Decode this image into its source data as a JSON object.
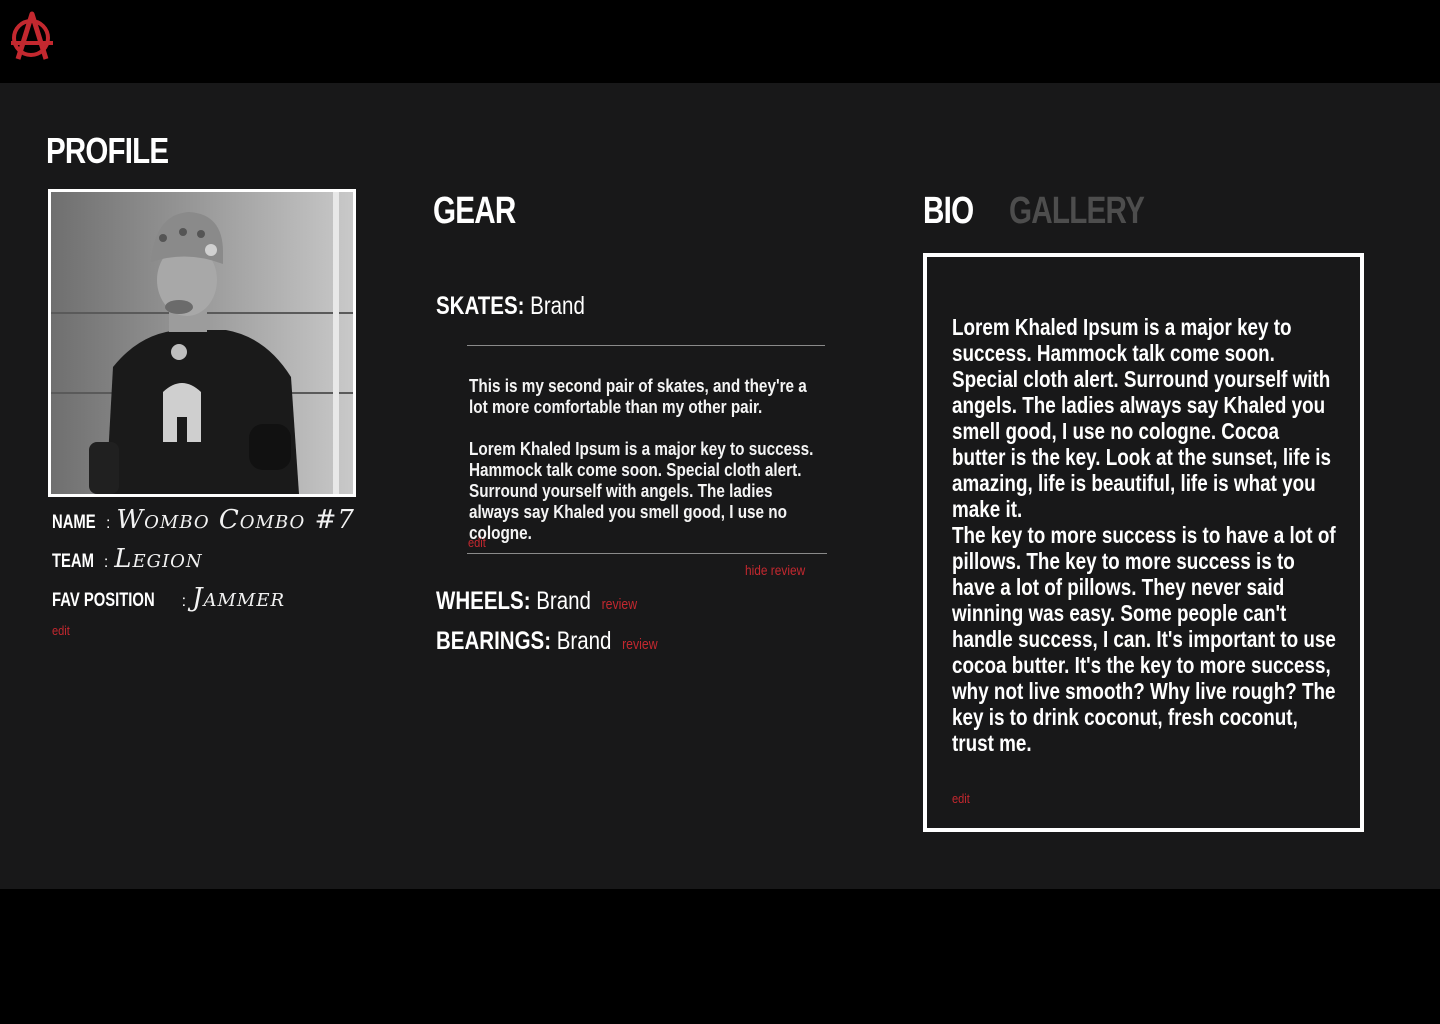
{
  "header": {
    "logo_icon": "anarchy-a-icon",
    "accent_color": "#c3282f"
  },
  "profile": {
    "title": "PROFILE",
    "photo_alt": "Profile photo of skater in helmet",
    "fields": [
      {
        "label": "NAME",
        "value": "Wombo Combo #7"
      },
      {
        "label": "TEAM",
        "value": "Legion"
      },
      {
        "label": "FAV POSITION",
        "value": "Jammer"
      }
    ],
    "edit_label": "edit"
  },
  "gear": {
    "title": "GEAR",
    "skates": {
      "label": "SKATES:",
      "brand": "Brand",
      "review_paragraph_1": "This is my second pair of skates, and they're a lot more comfortable than my other pair.",
      "review_paragraph_2": "Lorem Khaled Ipsum is a major key to success. Hammock talk come soon. Special cloth alert. Surround yourself with angels. The ladies always say Khaled you smell good, I use no cologne.",
      "edit_label": "edit",
      "hide_review_label": "hide review"
    },
    "wheels": {
      "label": "WHEELS:",
      "brand": "Brand",
      "review_label": "review"
    },
    "bearings": {
      "label": "BEARINGS:",
      "brand": "Brand",
      "review_label": "review"
    }
  },
  "bio": {
    "tabs": [
      {
        "label": "BIO",
        "active": true
      },
      {
        "label": "GALLERY",
        "active": false
      }
    ],
    "paragraph_1": "Lorem Khaled Ipsum is a major key to success. Hammock talk come soon. Special cloth alert. Surround yourself with angels. The ladies always say Khaled you smell good, I use no cologne. Cocoa butter is the key. Look at the sunset, life is amazing, life is beautiful, life is what you make it.",
    "paragraph_2": "The key to more success is to have a lot of pillows. The key to more success is to have a lot of pillows. They never said winning was easy. Some people can't handle success, I can. It's important to use cocoa butter. It's the key to more success, why not live smooth? Why live rough? The key is to drink coconut, fresh coconut, trust me.",
    "edit_label": "edit"
  }
}
